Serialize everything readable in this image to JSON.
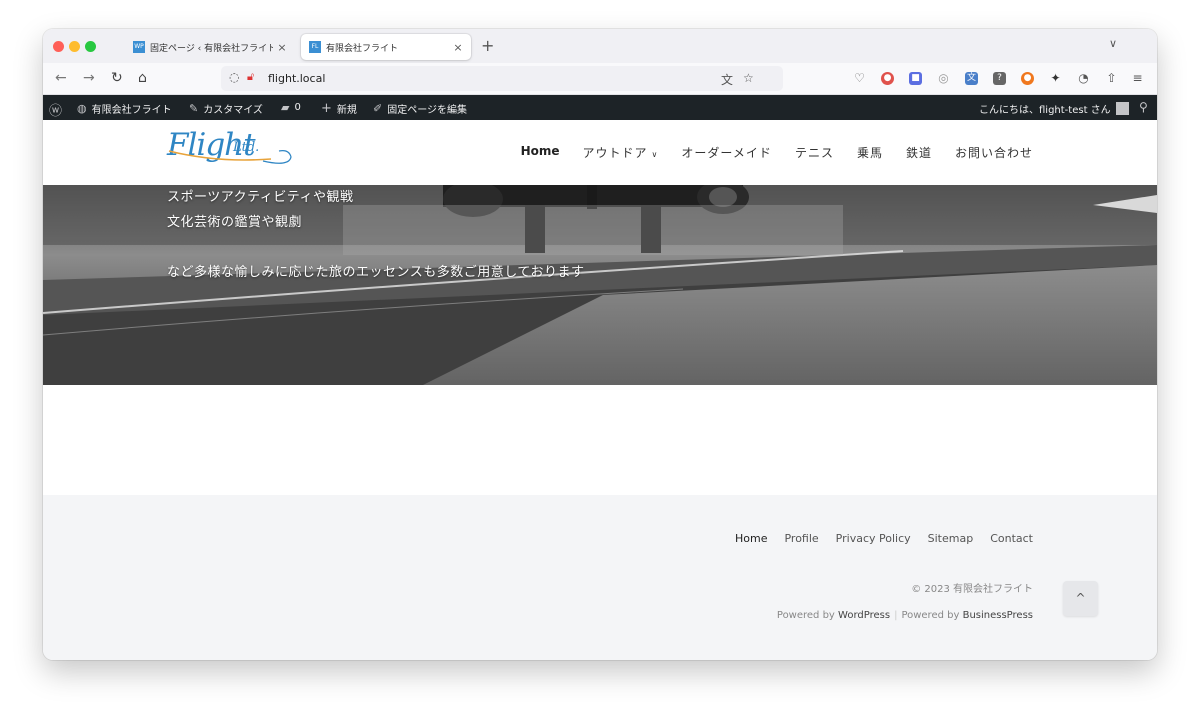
{
  "browser": {
    "tabs": [
      {
        "title": "固定ページ ‹ 有限会社フライト — WordPress",
        "favicon": "WP"
      },
      {
        "title": "有限会社フライト",
        "favicon": "FL"
      }
    ],
    "close_glyph": "×",
    "new_tab_glyph": "+",
    "tab_list_glyph": "∨",
    "url": "flight.local",
    "nav_icons": [
      "back-arrow-icon",
      "forward-arrow-icon",
      "reload-icon",
      "home-icon"
    ],
    "extension_colors": [
      "#e0524c",
      "#5b6ee1",
      "#999999",
      "#4a7fc9",
      "#666666",
      "#f0781e",
      "#333333",
      "#555555"
    ]
  },
  "admin_bar": {
    "site_name": "有限会社フライト",
    "customize": "カスタマイズ",
    "comments_count": "0",
    "new": "新規",
    "edit_page": "固定ページを編集",
    "greeting": "こんにちは、flight-test さん"
  },
  "site": {
    "logo_text": "Flight",
    "logo_ltd": "Ltd.",
    "nav": [
      {
        "label": "Home",
        "current": true
      },
      {
        "label": "アウトドア",
        "has_dropdown": true
      },
      {
        "label": "オーダーメイド"
      },
      {
        "label": "テニス"
      },
      {
        "label": "乗馬"
      },
      {
        "label": "鉄道"
      },
      {
        "label": "お問い合わせ"
      }
    ],
    "hero_lines": [
      "スポーツアクティビティや観戦",
      "文化芸術の鑑賞や観劇",
      "など多様な愉しみに応じた旅のエッセンスも多数ご用意しております"
    ]
  },
  "footer": {
    "nav": [
      "Home",
      "Profile",
      "Privacy Policy",
      "Sitemap",
      "Contact"
    ],
    "copyright": "© 2023 有限会社フライト",
    "powered_prefix_1": "Powered by ",
    "powered_link_1": "WordPress",
    "powered_separator": "|",
    "powered_prefix_2": "Powered by ",
    "powered_link_2": "BusinessPress",
    "to_top_glyph": "^"
  }
}
